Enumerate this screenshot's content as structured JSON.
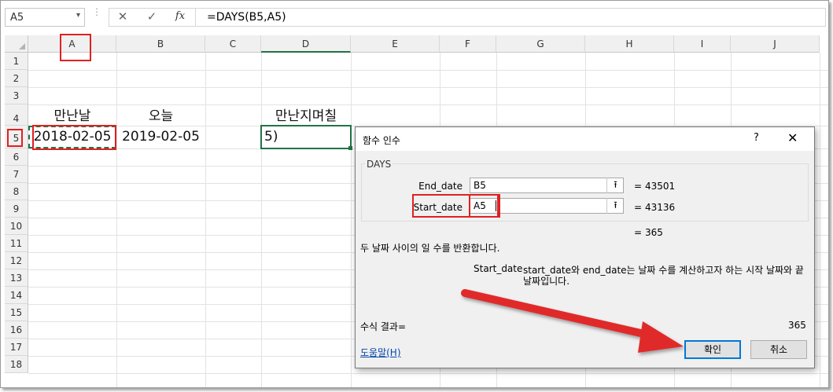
{
  "formula_bar": {
    "name_box": "A5",
    "name_box_dropdown": "▾",
    "cancel_icon": "✕",
    "enter_icon": "✓",
    "fx_label": "fx",
    "formula": "=DAYS(B5,A5)"
  },
  "columns": [
    "A",
    "B",
    "C",
    "D",
    "E",
    "F",
    "G",
    "H",
    "I",
    "J"
  ],
  "rows": [
    "1",
    "2",
    "3",
    "4",
    "5",
    "6",
    "7",
    "8",
    "9",
    "10",
    "11",
    "12",
    "13",
    "14",
    "15",
    "16",
    "17",
    "18"
  ],
  "cells": {
    "A4": "만난날",
    "B4": "오늘",
    "D4": "만난지며칠",
    "A5": "2018-02-05",
    "B5": "2019-02-05",
    "D5": "5)"
  },
  "dialog": {
    "title": "함수 인수",
    "help_glyph": "?",
    "close_glyph": "✕",
    "function_name": "DAYS",
    "args": [
      {
        "label": "End_date",
        "value": "B5",
        "result": "43501"
      },
      {
        "label": "Start_date",
        "value": "A5",
        "result": "43136"
      }
    ],
    "ref_button_glyph": "⭱",
    "eq_sign": "=",
    "overall_result": "365",
    "description": "두 날짜 사이의 일 수를 반환합니다.",
    "arg_help_name": "Start_date",
    "arg_help_text_line1": "start_date와 end_date는 날짜 수를 계산하고자 하는 시작 날짜와 끝",
    "arg_help_text_line2": "날짜입니다.",
    "formula_result_label": "수식 결과=",
    "formula_result_value": "365",
    "help_link": "도움말(H)",
    "ok_label": "확인",
    "cancel_label": "취소"
  },
  "colors": {
    "annotation_red": "#e02020",
    "accent_blue": "#0078d7",
    "active_cell_green": "#217346"
  }
}
